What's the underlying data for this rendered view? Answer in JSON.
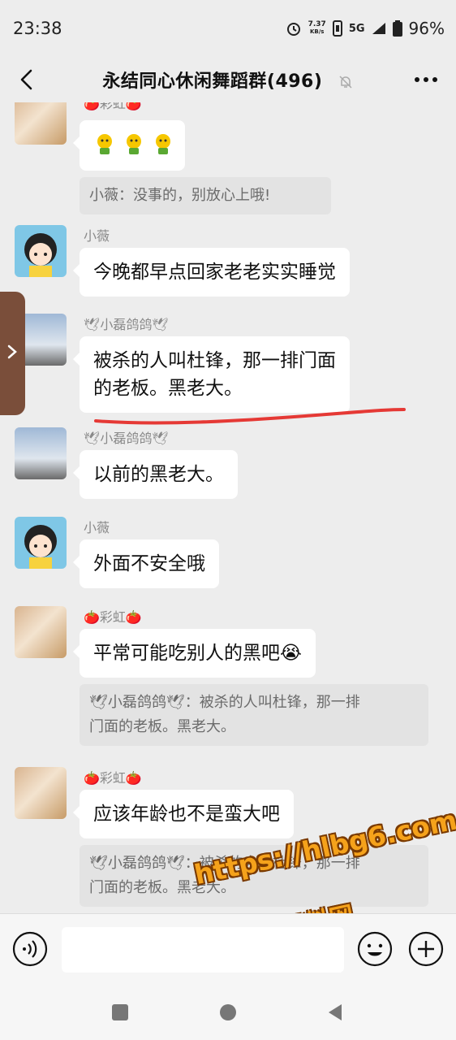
{
  "status_bar": {
    "time": "23:38",
    "net_speed_value": "7.37",
    "net_speed_unit": "KB/s",
    "network": "5G",
    "battery": "96%"
  },
  "header": {
    "title": "永结同心休闲舞蹈群(496)"
  },
  "messages": [
    {
      "sender": "🍅彩虹🍅",
      "quote": "小薇：没事的，别放心上哦!"
    },
    {
      "sender": "小薇",
      "text": "今晚都早点回家老老实实睡觉"
    },
    {
      "sender": "🕊小磊鸽鸽🕊",
      "text_line1": "被杀的人叫杜锋，那一排门面",
      "text_line2": "的老板。黑老大。"
    },
    {
      "sender": "🕊小磊鸽鸽🕊",
      "text": "以前的黑老大。"
    },
    {
      "sender": "小薇",
      "text": "外面不安全哦"
    },
    {
      "sender": "🍅彩虹🍅",
      "text": "平常可能吃别人的黑吧",
      "emoji": "😭",
      "quote_line1": "🕊小磊鸽鸽🕊：被杀的人叫杜锋，那一排",
      "quote_line2": "门面的老板。黑老大。"
    },
    {
      "sender": "🍅彩虹🍅",
      "text": "应该年龄也不是蛮大吧",
      "quote_line1": "🕊小磊鸽鸽🕊：被杀的人叫杜锋，那一排",
      "quote_line2": "门面的老板。黑老大。"
    }
  ],
  "watermark": {
    "url": "https://hlbg6.com",
    "label": "黑料网"
  },
  "colors": {
    "background": "#ededed",
    "bubble": "#ffffff",
    "quote": "#e3e3e3",
    "annotation_line": "#e53935",
    "watermark": "#f5a21b"
  }
}
